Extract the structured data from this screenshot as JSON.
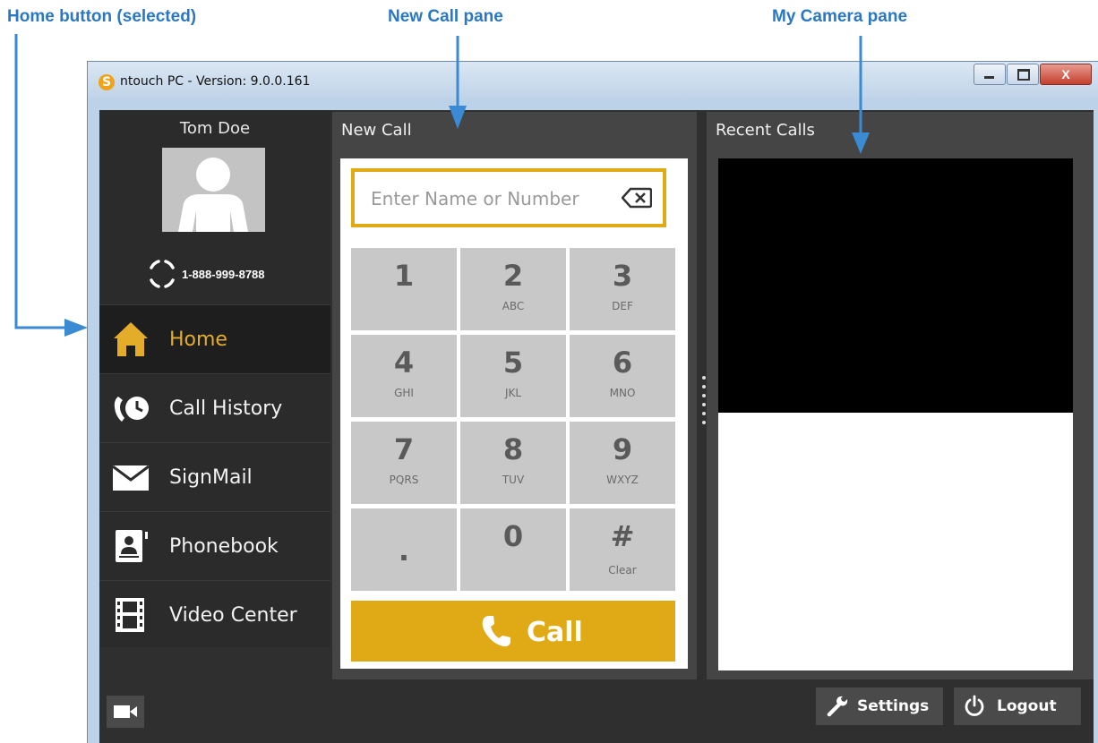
{
  "annotations": {
    "home_button": "Home button (selected)",
    "new_call_pane": "New Call pane",
    "camera_pane": "My Camera pane"
  },
  "window": {
    "title": "ntouch PC  -  Version:  9.0.0.161",
    "close_glyph": "X"
  },
  "user": {
    "name": "Tom Doe",
    "phone": "1-888-999-8788"
  },
  "nav": {
    "items": [
      {
        "label": "Home",
        "icon": "home-icon"
      },
      {
        "label": "Call History",
        "icon": "call-history-icon"
      },
      {
        "label": "SignMail",
        "icon": "envelope-icon"
      },
      {
        "label": "Phonebook",
        "icon": "phonebook-icon"
      },
      {
        "label": "Video Center",
        "icon": "film-icon"
      }
    ],
    "selected": "Home"
  },
  "new_call": {
    "title": "New Call",
    "search_placeholder": "Enter Name or Number",
    "keys": [
      {
        "digit": "1",
        "letters": ""
      },
      {
        "digit": "2",
        "letters": "ABC"
      },
      {
        "digit": "3",
        "letters": "DEF"
      },
      {
        "digit": "4",
        "letters": "GHI"
      },
      {
        "digit": "5",
        "letters": "JKL"
      },
      {
        "digit": "6",
        "letters": "MNO"
      },
      {
        "digit": "7",
        "letters": "PQRS"
      },
      {
        "digit": "8",
        "letters": "TUV"
      },
      {
        "digit": "9",
        "letters": "WXYZ"
      },
      {
        "digit": ".",
        "letters": ""
      },
      {
        "digit": "0",
        "letters": ""
      },
      {
        "digit": "#",
        "letters": "Clear"
      }
    ],
    "call_label": "Call"
  },
  "recent_calls": {
    "title": "Recent Calls"
  },
  "footer": {
    "settings_label": "Settings",
    "logout_label": "Logout"
  },
  "colors": {
    "accent": "#e0aa17",
    "callout": "#2b78c2",
    "app_bg": "#2f2f2f",
    "pane_bg": "#454545"
  }
}
